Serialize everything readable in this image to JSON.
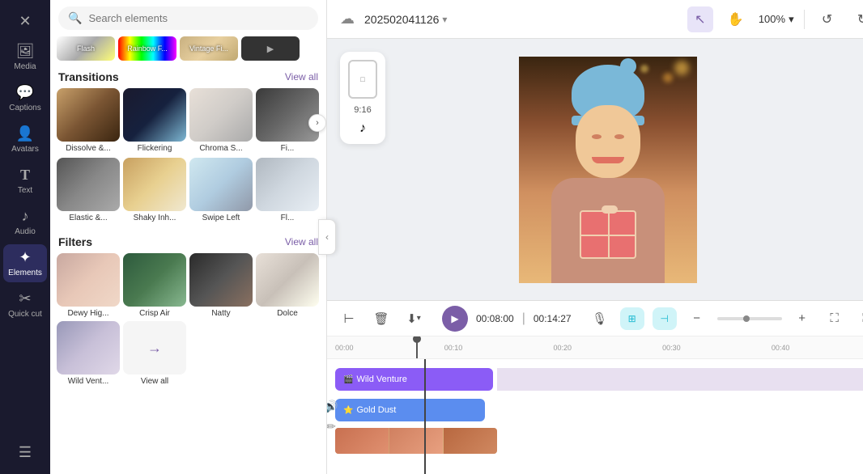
{
  "sidebar": {
    "items": [
      {
        "id": "logo",
        "icon": "✕",
        "label": "",
        "active": false
      },
      {
        "id": "media",
        "icon": "🖼",
        "label": "Media",
        "active": false
      },
      {
        "id": "captions",
        "icon": "💬",
        "label": "Captions",
        "active": false
      },
      {
        "id": "avatars",
        "icon": "👤",
        "label": "Avatars",
        "active": false
      },
      {
        "id": "text",
        "icon": "T",
        "label": "Text",
        "active": false
      },
      {
        "id": "audio",
        "icon": "♪",
        "label": "Audio",
        "active": false
      },
      {
        "id": "elements",
        "icon": "✦",
        "label": "Elements",
        "active": true
      },
      {
        "id": "quickcut",
        "icon": "✂",
        "label": "Quick cut",
        "active": false
      },
      {
        "id": "subtitles",
        "icon": "☰",
        "label": "",
        "active": false
      }
    ]
  },
  "search": {
    "placeholder": "Search elements"
  },
  "thumb_strip": [
    {
      "label": "Flash"
    },
    {
      "label": "Rainbow F..."
    },
    {
      "label": "Vintage Fi..."
    },
    {
      "label": "..."
    }
  ],
  "transitions": {
    "title": "Transitions",
    "view_all": "View all",
    "items": [
      {
        "label": "Dissolve &..."
      },
      {
        "label": "Flickering"
      },
      {
        "label": "Chroma S..."
      },
      {
        "label": "Fi..."
      }
    ],
    "items_row2": [
      {
        "label": "Elastic &..."
      },
      {
        "label": "Shaky Inh..."
      },
      {
        "label": "Swipe Left"
      },
      {
        "label": "Fl..."
      }
    ]
  },
  "filters": {
    "title": "Filters",
    "view_all": "View all",
    "items": [
      {
        "label": "Dewy Hig..."
      },
      {
        "label": "Crisp Air"
      },
      {
        "label": "Natty"
      },
      {
        "label": "Dolce"
      },
      {
        "label": "Wild Vent..."
      },
      {
        "label": "View all"
      }
    ]
  },
  "toolbar": {
    "cloud_title": "202502041126",
    "zoom": "100%",
    "undo": "↺",
    "redo": "↻"
  },
  "format": {
    "ratio": "9:16"
  },
  "timeline": {
    "play_time": "00:08:00",
    "total_time": "00:14:27",
    "ruler_marks": [
      "00:00",
      "00:10",
      "00:20",
      "00:30",
      "00:40"
    ],
    "tracks": [
      {
        "id": "track1",
        "clips": [
          {
            "label": "Wild Venture",
            "color": "purple",
            "width": 195
          }
        ]
      },
      {
        "id": "track2",
        "clips": [
          {
            "label": "Gold Dust",
            "color": "blue",
            "width": 185,
            "star": true
          }
        ]
      },
      {
        "id": "track3",
        "type": "photos"
      }
    ]
  }
}
